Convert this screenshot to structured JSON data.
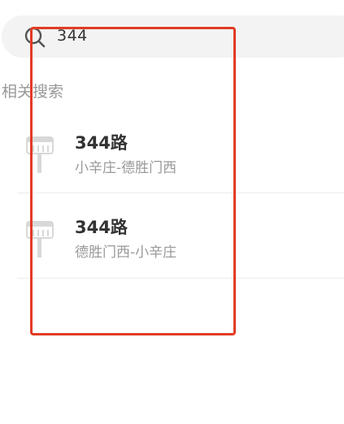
{
  "search": {
    "value": "344",
    "icon": "search-icon"
  },
  "section_title": "相关搜索",
  "results": [
    {
      "title": "344路",
      "subtitle": "小辛庄-德胜门西",
      "icon": "bus-stop-icon"
    },
    {
      "title": "344路",
      "subtitle": "德胜门西-小辛庄",
      "icon": "bus-stop-icon"
    }
  ],
  "colors": {
    "highlight": "#e23b24",
    "search_bg": "#f3f3f3",
    "muted_text": "#999999"
  }
}
